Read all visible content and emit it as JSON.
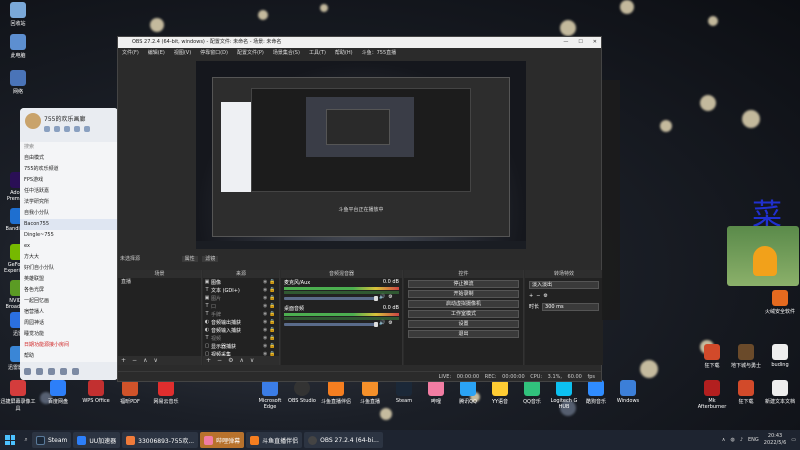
{
  "desktop": {
    "left_icons": [
      "此电脑",
      "网络",
      "回收站",
      "Adobe Premiere",
      "Bandicam",
      "GeForce Experience",
      "NVIDIA Broadcast",
      "迅雷",
      "迅雷影音"
    ],
    "bottom_icons": [
      "迅捷屏幕录像工具",
      "百度网盘",
      "WPS Office",
      "福昕PDF",
      "网易云音乐",
      "微信",
      "腾讯QQ",
      "Microsoft Edge",
      "OBS Studio",
      "斗鱼直播伴侣",
      "斗鱼直播",
      "Steam",
      "哔哩",
      "腾讯QQ",
      "YY语音",
      "QQ音乐",
      "Logitech G HUB",
      "酷狗音乐",
      "Windows"
    ],
    "right_icons": [
      "火绒安全软件",
      "Mk Afterburner",
      "地下城与勇士",
      "buding",
      "狂下载",
      "新建文本文档",
      "狂下载"
    ],
    "kanji": "菜"
  },
  "qq": {
    "title": "755的欢乐画廊",
    "search_placeholder": "搜索",
    "groups": [
      "自由模式",
      "755的欢乐频道",
      "FPS游戏",
      "任中活跃嘉",
      "法学研究所",
      "自我小分队",
      "Bacon755",
      "Dingle~755",
      "ex",
      "方大大",
      "好们自小分队",
      "英雄联盟",
      "各色光屏",
      "一起回忆画",
      "宿营播人",
      "周园神话",
      "睡觉功能",
      "日期功能源接小房间",
      "帮助"
    ]
  },
  "obs": {
    "title": "OBS 27.2.4 (64-bit, windows) - 配置文件: 未命名 - 场景: 未命名",
    "menu": [
      "文件(F)",
      "编辑(E)",
      "视图(V)",
      "停靠窗口(D)",
      "配置文件(P)",
      "场景集合(S)",
      "工具(T)",
      "帮助(H)",
      "斗鱼：755直播"
    ],
    "preview_caption": "斗鱼平台正在播放中",
    "dock_title": "未选择源",
    "prop_btn": "属性",
    "filter_btn": "滤镜",
    "scenes_header": "场景",
    "scenes": [
      "直播"
    ],
    "sources_header": "来源",
    "sources": [
      {
        "name": "图像",
        "icon": "▣"
      },
      {
        "name": "文本 (GDI+)",
        "icon": "T"
      },
      {
        "name": "图片",
        "icon": "▣"
      },
      {
        "name": "口",
        "icon": "T"
      },
      {
        "name": "手牌",
        "icon": "T"
      },
      {
        "name": "音频输出捕获",
        "icon": "◐"
      },
      {
        "name": "音频输入捕获",
        "icon": "◐"
      },
      {
        "name": "视频",
        "icon": "T"
      },
      {
        "name": "显示器捕获",
        "icon": "▢"
      },
      {
        "name": "视频采集",
        "icon": "▢"
      },
      {
        "name": "多媒体",
        "icon": "▢"
      }
    ],
    "mixer_header": "音频混音器",
    "mixer": [
      {
        "name": "麦克风/Aux",
        "db": "0.0 dB"
      },
      {
        "name": "桌面音频",
        "db": "0.0 dB"
      }
    ],
    "controls_header": "控件",
    "controls": [
      "停止推流",
      "开始录制",
      "启动虚拟摄像机",
      "工作室模式",
      "设置",
      "退出"
    ],
    "transitions_header": "转场特效",
    "transition": "淡入淡出",
    "duration_label": "时长",
    "duration": "300 ms",
    "status": "LIVE: 00:00:00  REC: 00:00:00  CPU: 3.1%, 60.00 fps"
  },
  "taskbar": {
    "apps": [
      {
        "label": "Steam",
        "color": "#1b2838",
        "state": "open"
      },
      {
        "label": "UU加速器",
        "color": "#2d7ff9",
        "state": "open"
      },
      {
        "label": "33006893-755欢...",
        "color": "#f07b3a",
        "state": "open"
      },
      {
        "label": "哔哩弹幕",
        "color": "#f27da3",
        "state": "active"
      },
      {
        "label": "斗鱼直播伴侣",
        "color": "#f57e20",
        "state": "open"
      },
      {
        "label": "OBS 27.2.4 (64-bi...",
        "color": "#444",
        "state": "open"
      }
    ],
    "lang": "ENG",
    "time": "20:43",
    "date": "2022/5/6"
  }
}
